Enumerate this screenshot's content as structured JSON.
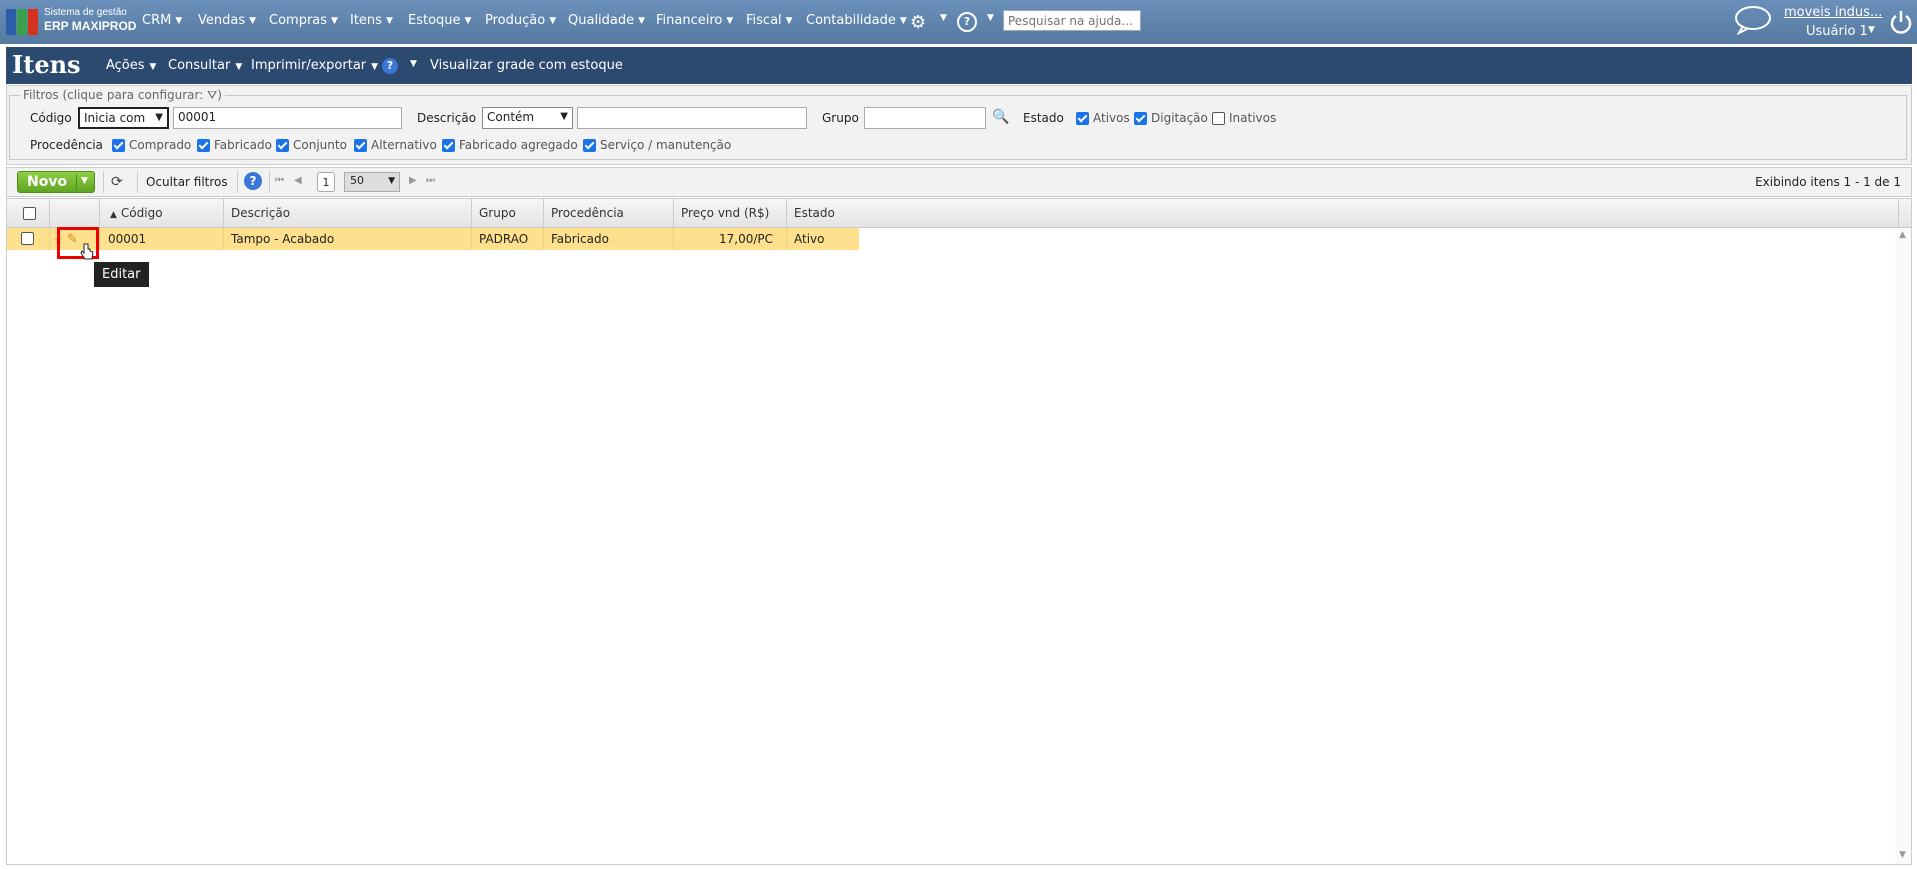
{
  "app": {
    "logo_line1": "Sistema de gestão",
    "logo_line2": "ERP MAXIPROD",
    "logo_colors": [
      "#2b5ea8",
      "#3aa14a",
      "#d4321c"
    ]
  },
  "topnav": {
    "menus": [
      "CRM",
      "Vendas",
      "Compras",
      "Itens",
      "Estoque",
      "Produção",
      "Qualidade",
      "Financeiro",
      "Fiscal",
      "Contabilidade"
    ],
    "search_placeholder": "Pesquisar na ajuda...",
    "company_link": "moveis indus...",
    "user_label": "Usuário 1",
    "icons": [
      "gear-icon",
      "help-icon",
      "chat-icon",
      "power-icon"
    ]
  },
  "titlebar": {
    "title": "Itens",
    "menus": [
      "Ações",
      "Consultar",
      "Imprimir/exportar"
    ],
    "grid_view": "Visualizar grade com estoque"
  },
  "filters": {
    "legend": "Filtros (clique para configurar:",
    "legend_close": ")",
    "codigo_label": "Código",
    "codigo_mode": "Inicia com",
    "codigo_value": "00001",
    "descricao_label": "Descrição",
    "descricao_mode": "Contém",
    "descricao_value": "",
    "grupo_label": "Grupo",
    "grupo_value": "",
    "estado_label": "Estado",
    "estado_options": [
      {
        "label": "Ativos",
        "checked": true
      },
      {
        "label": "Digitação",
        "checked": true
      },
      {
        "label": "Inativos",
        "checked": false
      }
    ],
    "procedencia_label": "Procedência",
    "procedencia_options": [
      {
        "label": "Comprado",
        "checked": true
      },
      {
        "label": "Fabricado",
        "checked": true
      },
      {
        "label": "Conjunto",
        "checked": true
      },
      {
        "label": "Alternativo",
        "checked": true
      },
      {
        "label": "Fabricado agregado",
        "checked": true
      },
      {
        "label": "Serviço / manutenção",
        "checked": true
      }
    ]
  },
  "toolbar": {
    "new_label": "Novo",
    "hide_filters_label": "Ocultar filtros",
    "page": "1",
    "page_size": "50",
    "showing": "Exibindo itens 1 - 1 de 1"
  },
  "grid": {
    "columns": [
      "Código",
      "Descrição",
      "Grupo",
      "Procedência",
      "Preço vnd (R$)",
      "Estado"
    ],
    "sort_column": "Código",
    "rows": [
      {
        "codigo": "00001",
        "descricao": "Tampo - Acabado",
        "grupo": "PADRAO",
        "procedencia": "Fabricado",
        "preco": "17,00/PC",
        "estado": "Ativo"
      }
    ],
    "row_highlight_color": "#ffe08c",
    "tooltip": "Editar"
  }
}
